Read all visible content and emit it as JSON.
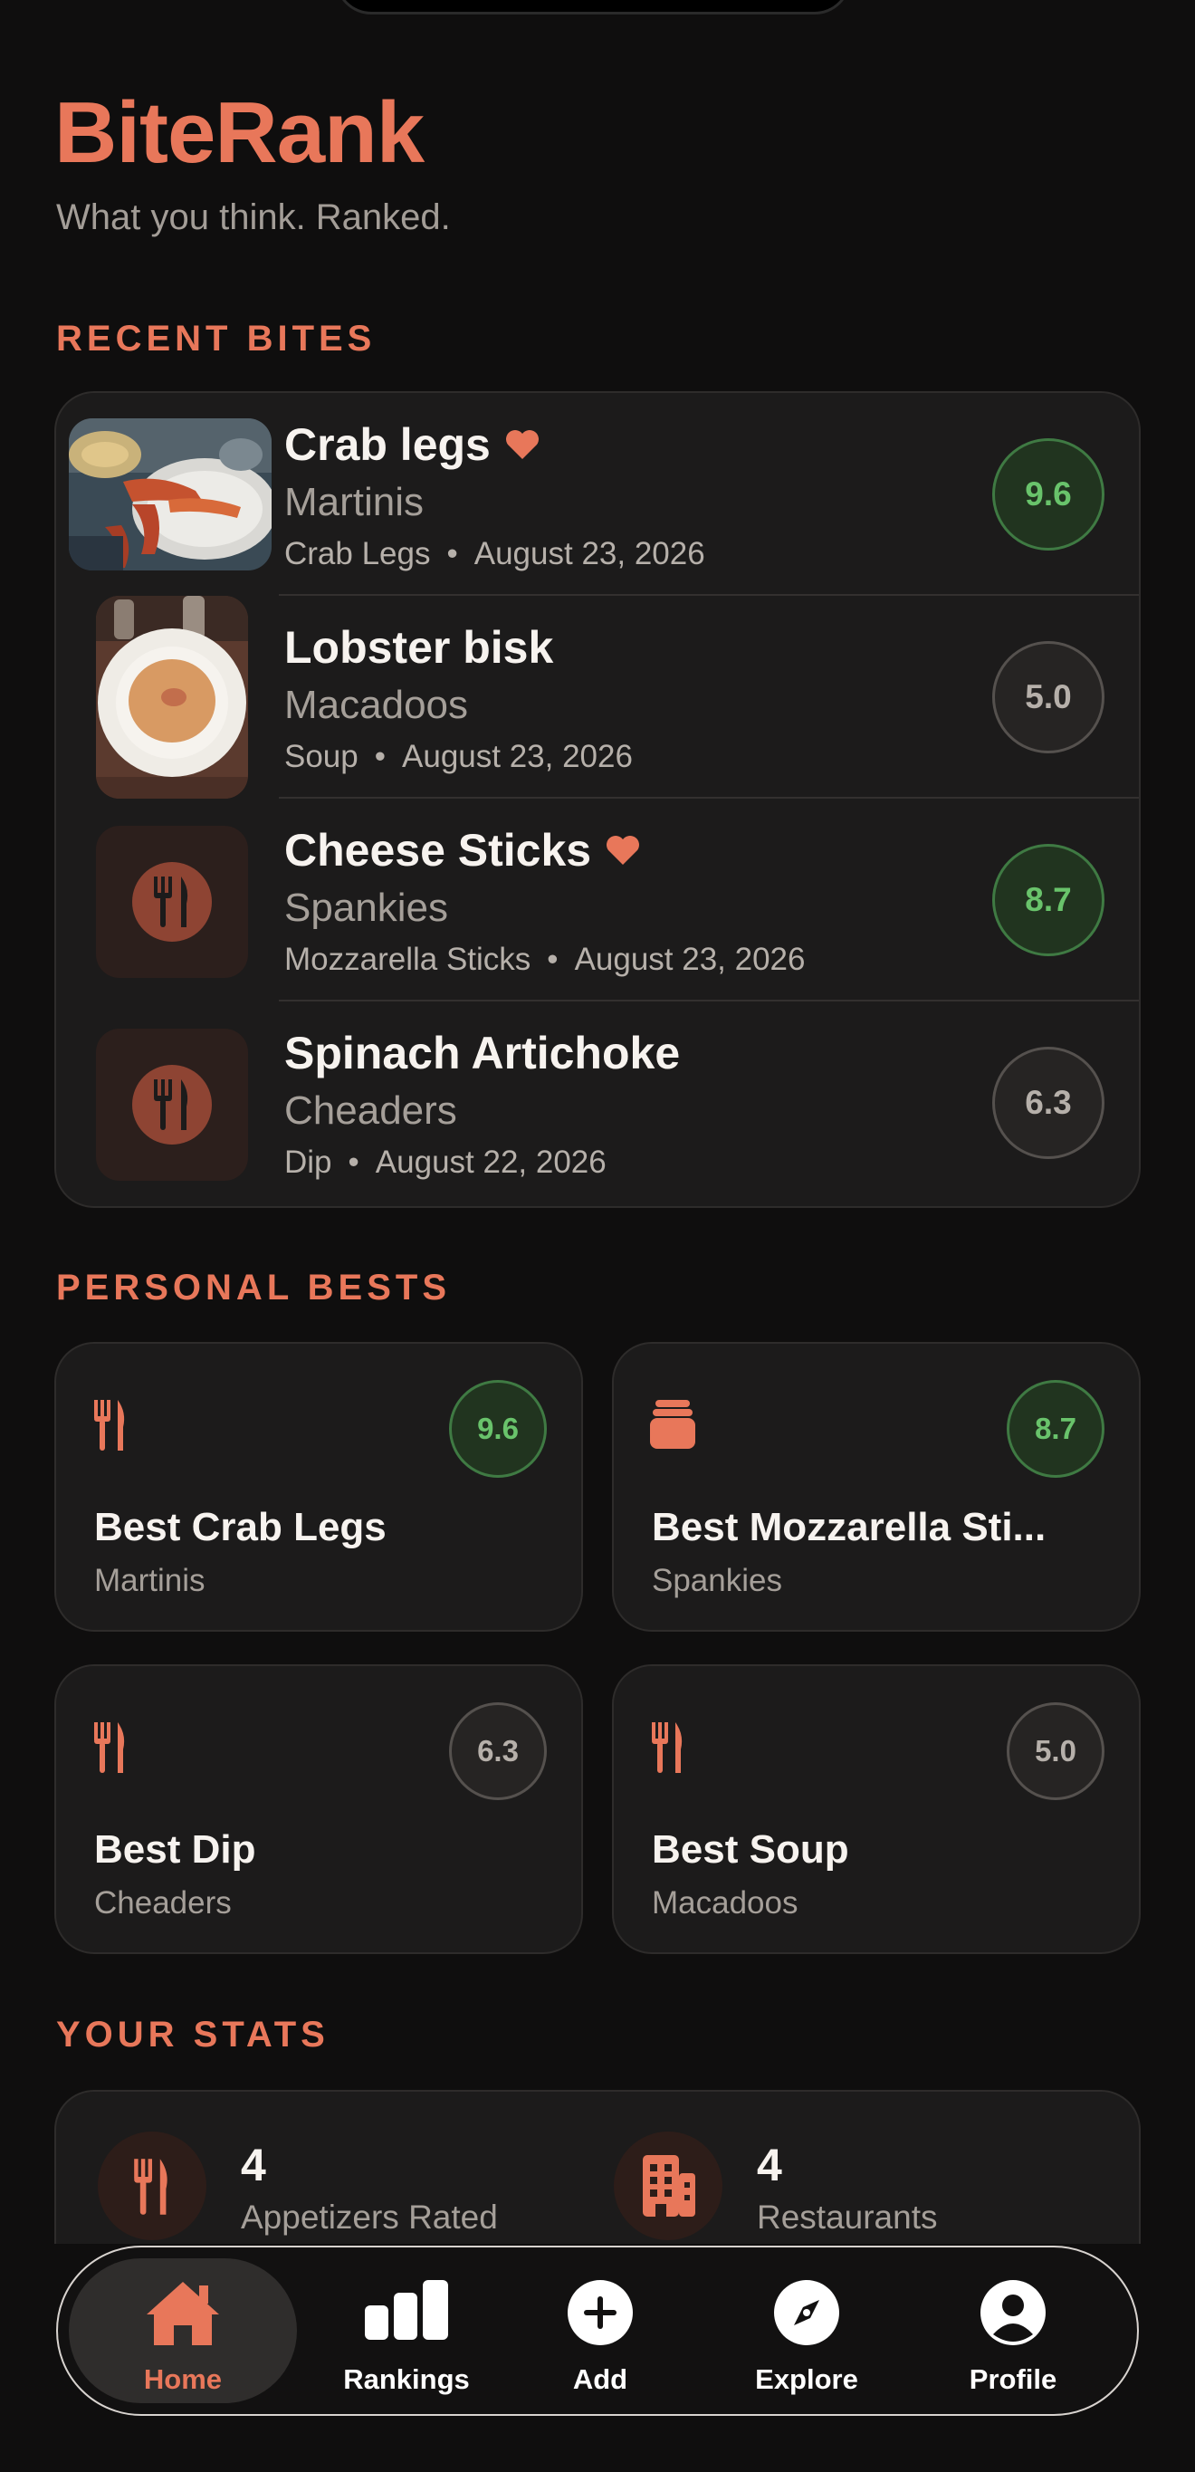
{
  "app": {
    "title": "BiteRank",
    "subtitle": "What you think. Ranked."
  },
  "colors": {
    "accent": "#e8775a",
    "good_score": "#69c36b",
    "neutral_score": "#b6b0aa",
    "background": "#0f0e0e"
  },
  "recent": {
    "title": "RECENT BITES",
    "items": [
      {
        "name": "Crab legs",
        "favorite": true,
        "restaurant": "Martinis",
        "category": "Crab Legs",
        "date": "August 23, 2026",
        "score": "9.6",
        "image": "photo-crab-legs"
      },
      {
        "name": "Lobster bisk",
        "favorite": false,
        "restaurant": "Macadoos",
        "category": "Soup",
        "date": "August 23, 2026",
        "score": "5.0",
        "image": "photo-lobster-bisque"
      },
      {
        "name": "Cheese Sticks",
        "favorite": true,
        "restaurant": "Spankies",
        "category": "Mozzarella Sticks",
        "date": "August 23, 2026",
        "score": "8.7",
        "image": "fork-knife-icon"
      },
      {
        "name": "Spinach Artichoke",
        "favorite": false,
        "restaurant": "Cheaders",
        "category": "Dip",
        "date": "August 22, 2026",
        "score": "6.3",
        "image": "fork-knife-icon"
      }
    ],
    "separator": "•"
  },
  "bests": {
    "title": "PERSONAL BESTS",
    "items": [
      {
        "name": "Best Crab Legs",
        "restaurant": "Martinis",
        "score": "9.6",
        "icon": "fork-knife-icon"
      },
      {
        "name": "Best Mozzarella Sti...",
        "restaurant": "Spankies",
        "score": "8.7",
        "icon": "stack-icon"
      },
      {
        "name": "Best Dip",
        "restaurant": "Cheaders",
        "score": "6.3",
        "icon": "fork-knife-icon"
      },
      {
        "name": "Best Soup",
        "restaurant": "Macadoos",
        "score": "5.0",
        "icon": "fork-knife-icon"
      }
    ]
  },
  "stats": {
    "title": "YOUR STATS",
    "items": [
      {
        "value": "4",
        "label": "Appetizers Rated",
        "icon": "fork-knife-icon"
      },
      {
        "value": "4",
        "label": "Restaurants",
        "icon": "building-icon"
      }
    ]
  },
  "tabs": [
    {
      "label": "Home",
      "icon": "house-icon",
      "active": true
    },
    {
      "label": "Rankings",
      "icon": "bar-chart-icon",
      "active": false
    },
    {
      "label": "Add",
      "icon": "plus-circle-icon",
      "active": false
    },
    {
      "label": "Explore",
      "icon": "compass-icon",
      "active": false
    },
    {
      "label": "Profile",
      "icon": "person-circle-icon",
      "active": false
    }
  ]
}
